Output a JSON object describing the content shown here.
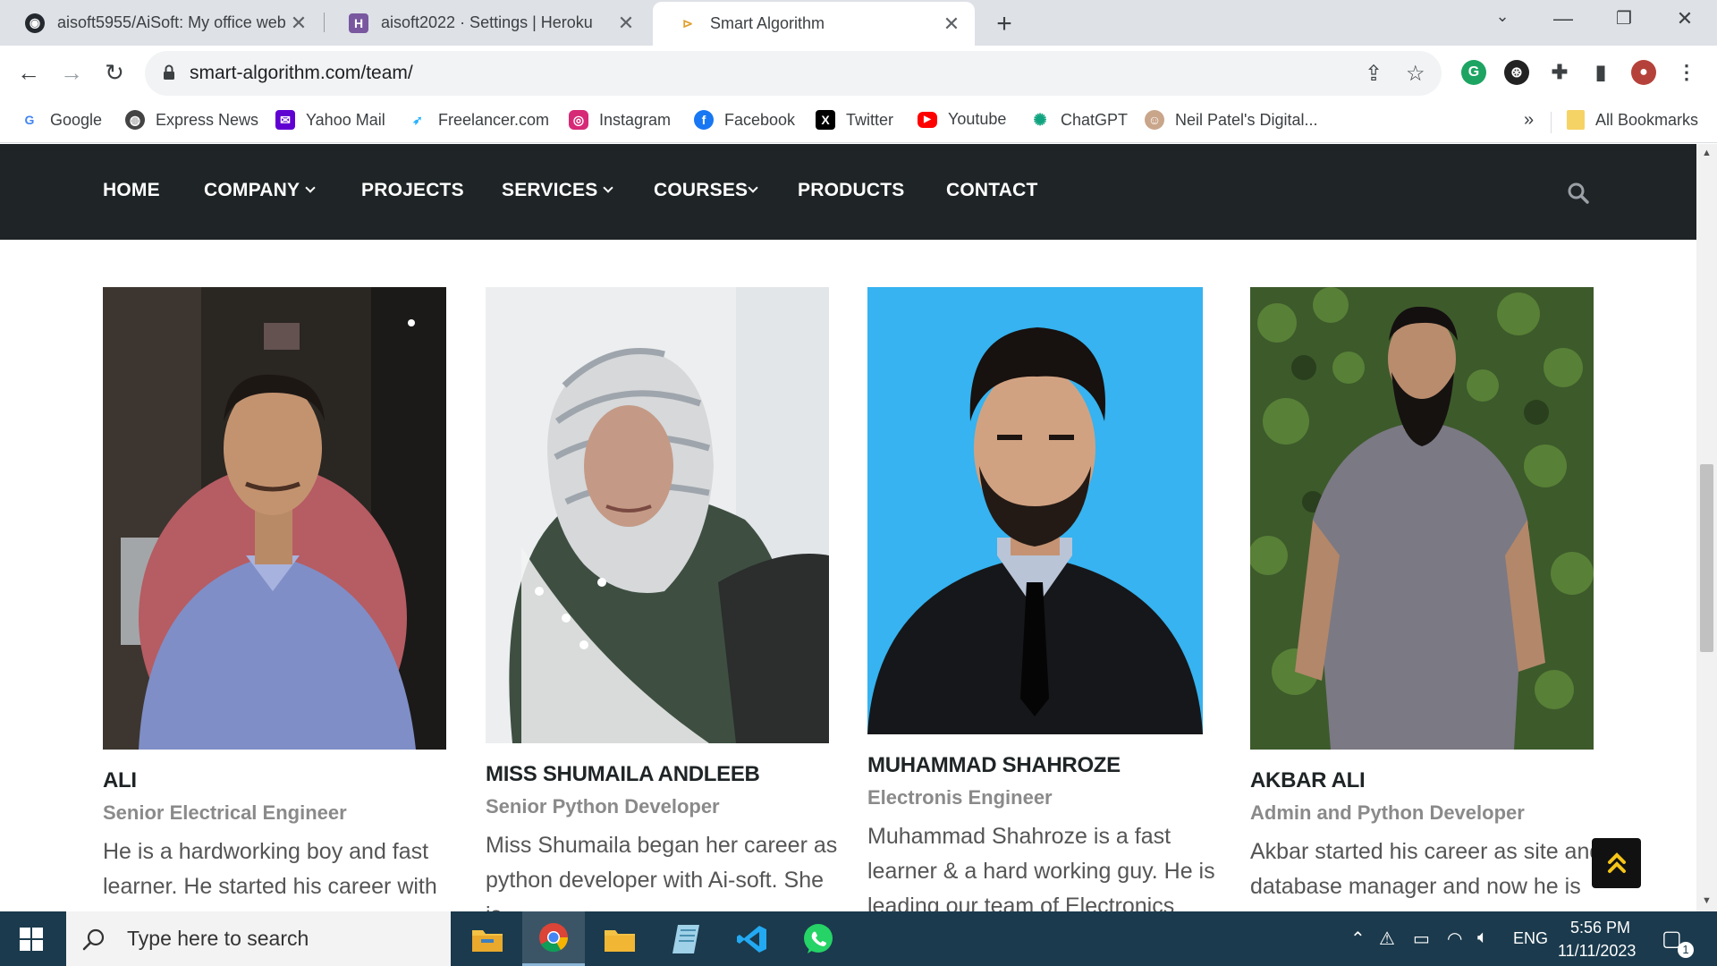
{
  "browser": {
    "tabs": [
      {
        "title": "aisoft5955/AiSoft: My office web",
        "icon": "github-icon"
      },
      {
        "title": "aisoft2022 · Settings | Heroku",
        "icon": "heroku-icon"
      },
      {
        "title": "Smart Algorithm",
        "icon": "smart-algorithm-icon"
      }
    ],
    "url": "smart-algorithm.com/team/",
    "bookmarks": [
      {
        "label": "Google",
        "icon": "google-icon"
      },
      {
        "label": "Express News",
        "icon": "globe-icon"
      },
      {
        "label": "Yahoo Mail",
        "icon": "mail-icon"
      },
      {
        "label": "Freelancer.com",
        "icon": "freelancer-icon"
      },
      {
        "label": "Instagram",
        "icon": "instagram-icon"
      },
      {
        "label": "Facebook",
        "icon": "facebook-icon"
      },
      {
        "label": "Twitter",
        "icon": "x-icon"
      },
      {
        "label": "Youtube",
        "icon": "youtube-icon"
      },
      {
        "label": "ChatGPT",
        "icon": "chatgpt-icon"
      },
      {
        "label": "Neil Patel's Digital...",
        "icon": "avatar-icon"
      }
    ],
    "all_bookmarks": "All Bookmarks",
    "overflow": "»"
  },
  "site": {
    "nav": [
      {
        "label": "HOME",
        "dropdown": false
      },
      {
        "label": "COMPANY",
        "dropdown": true
      },
      {
        "label": "PROJECTS",
        "dropdown": false
      },
      {
        "label": "SERVICES",
        "dropdown": true
      },
      {
        "label": "COURSES",
        "dropdown": true
      },
      {
        "label": "PRODUCTS",
        "dropdown": false
      },
      {
        "label": "CONTACT",
        "dropdown": false
      }
    ],
    "colors": {
      "nav_bg": "#1f2426",
      "text_dark": "#1f2426",
      "role_gray": "#8a8a8a",
      "bio_gray": "#555555",
      "totop_accent": "#f5c518"
    }
  },
  "team": [
    {
      "name": "ALI",
      "role": "Senior Electrical Engineer",
      "bio": "He is a hardworking boy and fast learner. He started his career with"
    },
    {
      "name": "MISS SHUMAILA ANDLEEB",
      "role": "Senior Python Developer",
      "bio": "Miss Shumaila began her career as python developer with Ai-soft. She is"
    },
    {
      "name": "MUHAMMAD SHAHROZE",
      "role": "Electronis Engineer",
      "bio": "Muhammad Shahroze is a fast learner & a hard working guy. He is leading our team of Electronics"
    },
    {
      "name": "AKBAR ALI",
      "role": "Admin and Python Developer",
      "bio": "Akbar started his career as site and database manager and now he is"
    }
  ],
  "taskbar": {
    "search_placeholder": "Type here to search",
    "language": "ENG",
    "time": "5:56 PM",
    "date": "11/11/2023",
    "notification_count": "1"
  }
}
